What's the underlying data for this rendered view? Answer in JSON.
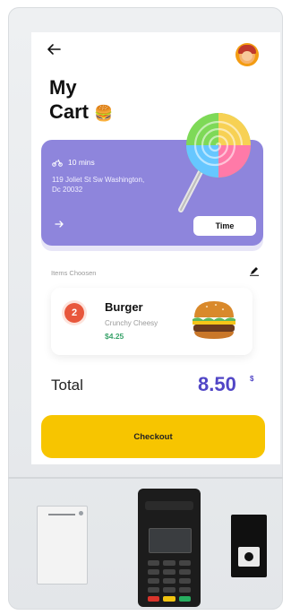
{
  "header": {
    "back_icon": "arrow-left-icon",
    "avatar": "user-avatar"
  },
  "title": {
    "line1": "My",
    "line2": "Cart",
    "emoji": "🍔"
  },
  "delivery": {
    "eta": "10 mins",
    "eta_icon": "scooter-icon",
    "address": "119 Joliet St Sw Washington, Dc 20032",
    "next_icon": "chevron-right-icon",
    "time_button": "Time",
    "card_color": "#8e85dc"
  },
  "items_section": {
    "label": "Items Choosen",
    "edit_icon": "pen-icon"
  },
  "items": [
    {
      "quantity": "2",
      "name": "Burger",
      "description": "Crunchy Cheesy",
      "price": "$4.25"
    }
  ],
  "summary": {
    "total_label": "Total",
    "total_value": "8.50",
    "currency": "$"
  },
  "checkout": {
    "label": "Checkout",
    "color": "#f7c500"
  },
  "colors": {
    "accent": "#5146c6",
    "price_green": "#3aa36b",
    "badge_red": "#e8573c"
  }
}
